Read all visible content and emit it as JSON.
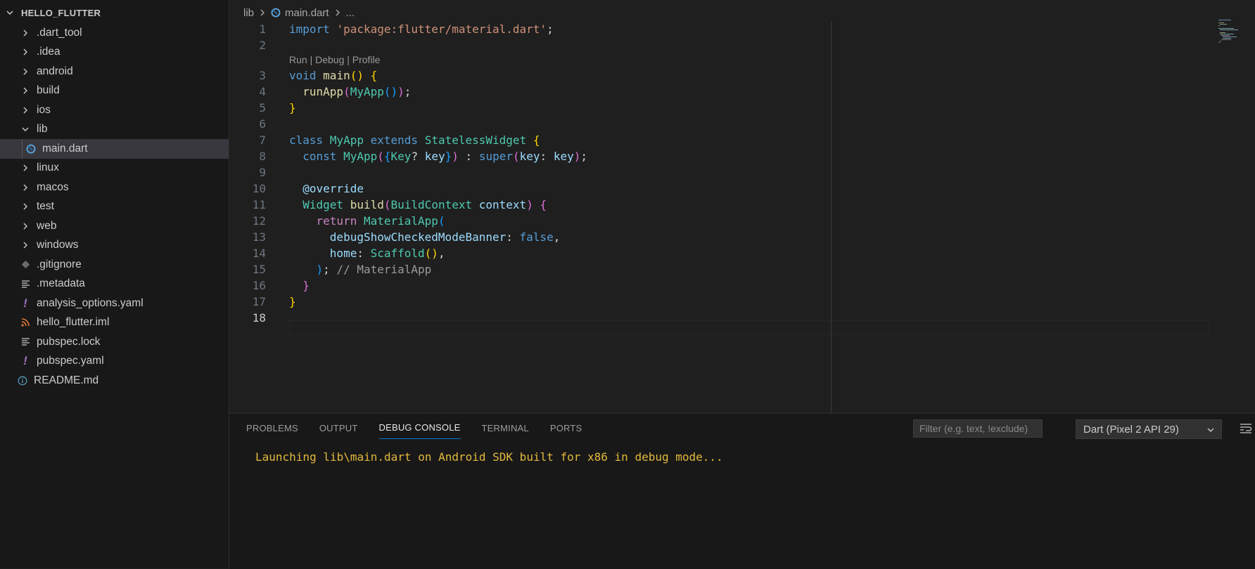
{
  "explorer": {
    "root": "HELLO_FLUTTER",
    "items": [
      {
        "label": ".dart_tool",
        "type": "folder",
        "expanded": false
      },
      {
        "label": ".idea",
        "type": "folder",
        "expanded": false
      },
      {
        "label": "android",
        "type": "folder",
        "expanded": false
      },
      {
        "label": "build",
        "type": "folder",
        "expanded": false
      },
      {
        "label": "ios",
        "type": "folder",
        "expanded": false
      },
      {
        "label": "lib",
        "type": "folder",
        "expanded": true
      },
      {
        "label": "main.dart",
        "type": "dart-file",
        "selected": true
      },
      {
        "label": "linux",
        "type": "folder",
        "expanded": false
      },
      {
        "label": "macos",
        "type": "folder",
        "expanded": false
      },
      {
        "label": "test",
        "type": "folder",
        "expanded": false
      },
      {
        "label": "web",
        "type": "folder",
        "expanded": false
      },
      {
        "label": "windows",
        "type": "folder",
        "expanded": false
      },
      {
        "label": ".gitignore",
        "type": "git-file"
      },
      {
        "label": ".metadata",
        "type": "text-file"
      },
      {
        "label": "analysis_options.yaml",
        "type": "yaml-file"
      },
      {
        "label": "hello_flutter.iml",
        "type": "rss-file"
      },
      {
        "label": "pubspec.lock",
        "type": "text-file"
      },
      {
        "label": "pubspec.yaml",
        "type": "yaml-file"
      },
      {
        "label": "README.md",
        "type": "info-file"
      }
    ]
  },
  "breadcrumb": {
    "folder": "lib",
    "file": "main.dart",
    "more": "..."
  },
  "editor": {
    "codelens": "Run | Debug | Profile",
    "current_line": 18,
    "lines": [
      {
        "n": 1,
        "text": "import 'package:flutter/material.dart';"
      },
      {
        "n": 2,
        "text": ""
      },
      {
        "n": 3,
        "text": "void main() {"
      },
      {
        "n": 4,
        "text": "  runApp(MyApp());"
      },
      {
        "n": 5,
        "text": "}"
      },
      {
        "n": 6,
        "text": ""
      },
      {
        "n": 7,
        "text": "class MyApp extends StatelessWidget {"
      },
      {
        "n": 8,
        "text": "  const MyApp({Key? key}) : super(key: key);"
      },
      {
        "n": 9,
        "text": ""
      },
      {
        "n": 10,
        "text": "  @override"
      },
      {
        "n": 11,
        "text": "  Widget build(BuildContext context) {"
      },
      {
        "n": 12,
        "text": "    return MaterialApp("
      },
      {
        "n": 13,
        "text": "      debugShowCheckedModeBanner: false,"
      },
      {
        "n": 14,
        "text": "      home: Scaffold(),"
      },
      {
        "n": 15,
        "text": "    ); // MaterialApp"
      },
      {
        "n": 16,
        "text": "  }"
      },
      {
        "n": 17,
        "text": "}"
      },
      {
        "n": 18,
        "text": ""
      }
    ]
  },
  "panel": {
    "tabs": [
      "PROBLEMS",
      "OUTPUT",
      "DEBUG CONSOLE",
      "TERMINAL",
      "PORTS"
    ],
    "active_tab": "DEBUG CONSOLE",
    "filter_placeholder": "Filter (e.g. text, !exclude)",
    "session_select": "Dart (Pixel 2 API 29)",
    "console_output": "Launching lib\\main.dart on Android SDK built for x86 in debug mode..."
  },
  "colors": {
    "accent": "#0078d4",
    "console_text": "#e2b93d",
    "selection": "#37373d"
  }
}
